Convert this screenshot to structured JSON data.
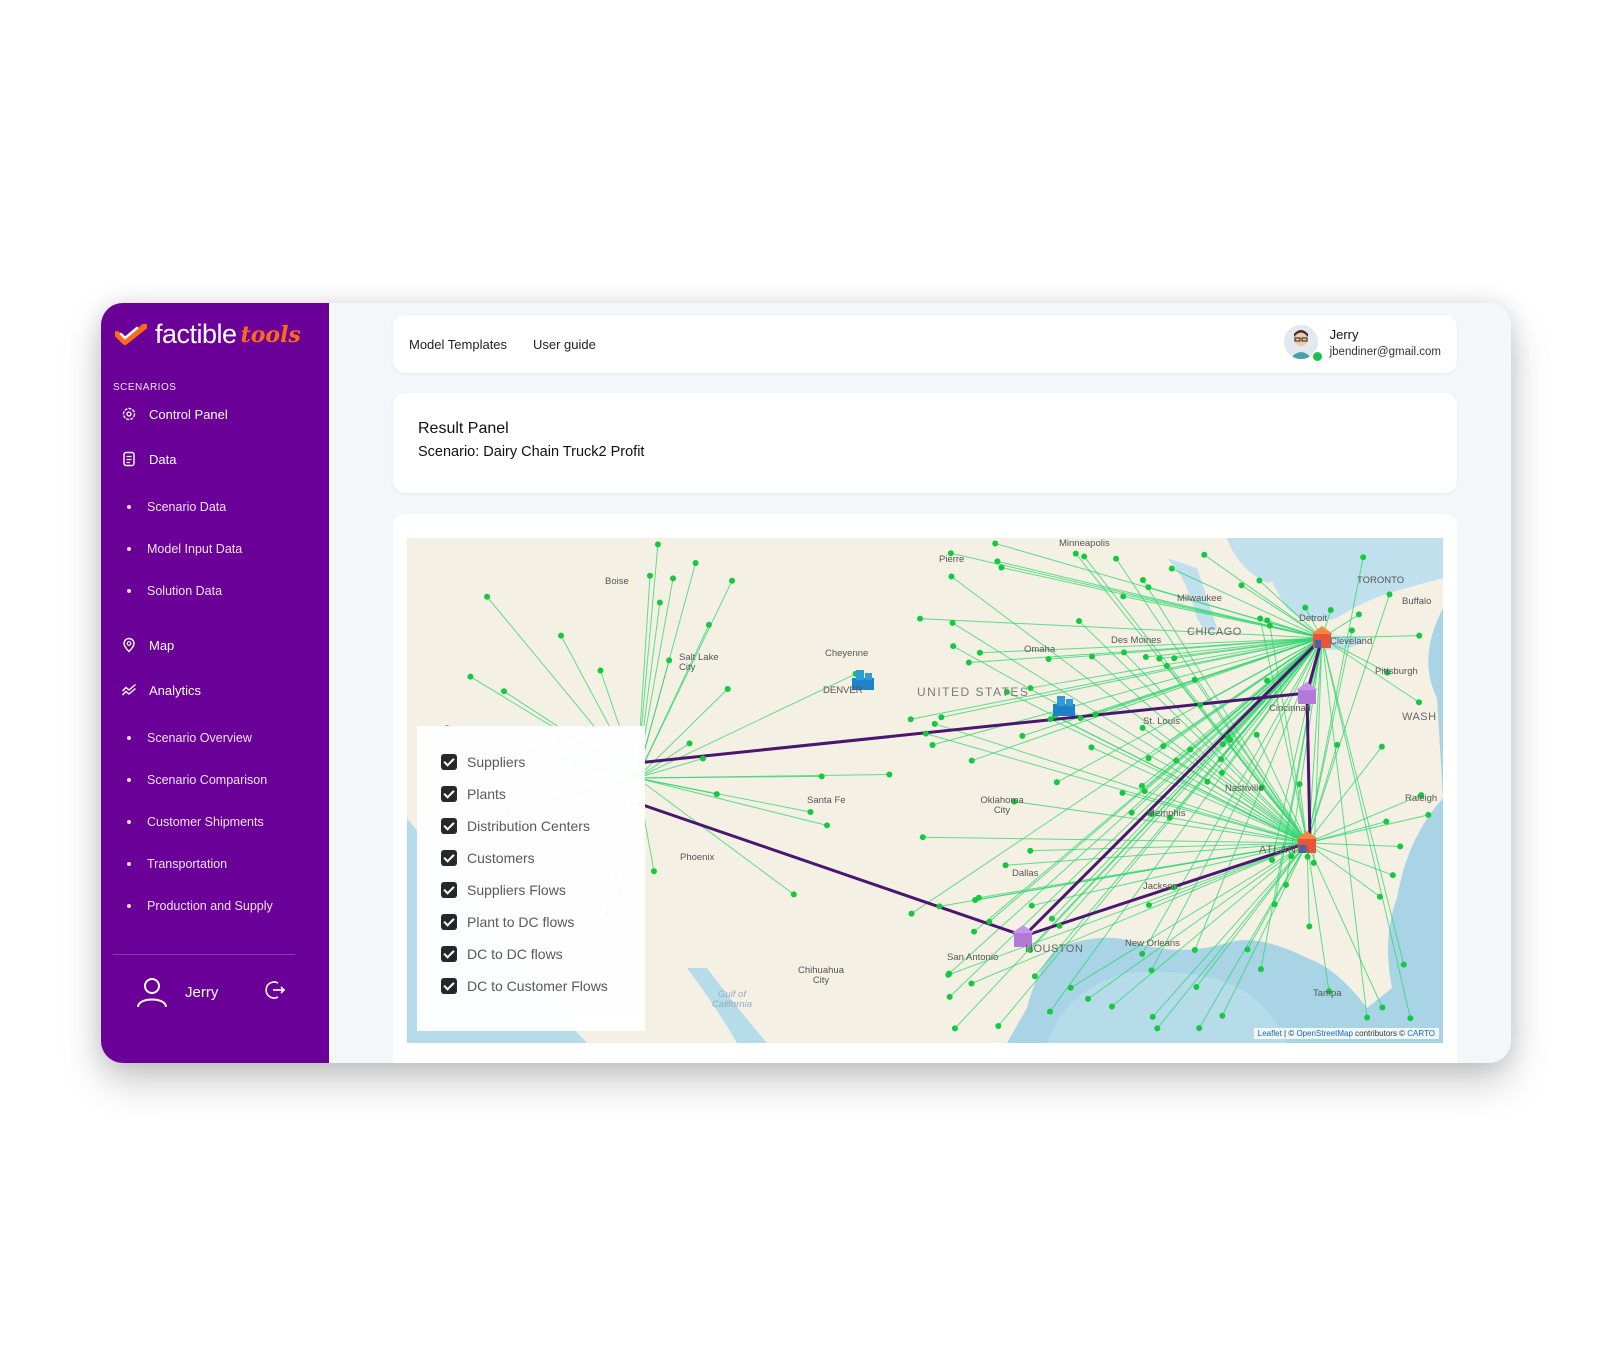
{
  "brand": {
    "name": "factible",
    "accent": "tools",
    "primary_color": "#6b0098",
    "accent_color": "#ff6a1a"
  },
  "sidebar": {
    "section_label": "SCENARIOS",
    "items": [
      {
        "label": "Control Panel",
        "icon": "gear-icon"
      },
      {
        "label": "Data",
        "icon": "document-icon"
      },
      {
        "label": "Scenario Data"
      },
      {
        "label": "Model Input Data"
      },
      {
        "label": "Solution Data"
      },
      {
        "label": "Map",
        "icon": "map-pin-icon"
      },
      {
        "label": "Analytics",
        "icon": "analytics-icon"
      },
      {
        "label": "Scenario Overview"
      },
      {
        "label": "Scenario Comparison"
      },
      {
        "label": "Customer Shipments"
      },
      {
        "label": "Transportation"
      },
      {
        "label": "Production and Supply"
      }
    ],
    "user_name": "Jerry"
  },
  "topbar": {
    "links": [
      "Model Templates",
      "User guide"
    ],
    "user": {
      "name": "Jerry",
      "email": "jbendiner@gmail.com"
    }
  },
  "result": {
    "title": "Result Panel",
    "scenario": "Scenario: Dairy Chain Truck2 Profit"
  },
  "map": {
    "country_label": "UNITED STATES",
    "cities": [
      "Minneapolis",
      "Pierre",
      "Boise",
      "TORONTO",
      "Buffalo",
      "Milwaukee",
      "Detroit",
      "Salt Lake City",
      "Cheyenne",
      "Omaha",
      "Des Moines",
      "CHICAGO",
      "Cleveland",
      "Pittsburgh",
      "DENVER",
      "St. Louis",
      "Cincinnati",
      "WASH",
      "Santa Fe",
      "Oklahoma City",
      "Nashville",
      "Raleigh",
      "Memphis",
      "Phoenix",
      "ATLANTA",
      "Dallas",
      "Jackson",
      "HOUSTON",
      "New Orleans",
      "San Antonio",
      "Chihuahua City",
      "Gulf of California",
      "Tampa"
    ],
    "legend": [
      "Suppliers",
      "Plants",
      "Distribution Centers",
      "Customers",
      "Suppliers Flows",
      "Plant to DC flows",
      "DC to DC flows",
      "DC to Customer Flows"
    ],
    "attribution": {
      "leaflet": "Leaflet",
      "mid": " | © ",
      "osm": "OpenStreetMap",
      "contrib": " contributors © ",
      "carto": "CARTO"
    },
    "flow_color": "#2bd66b",
    "route_color": "#4a1670"
  }
}
